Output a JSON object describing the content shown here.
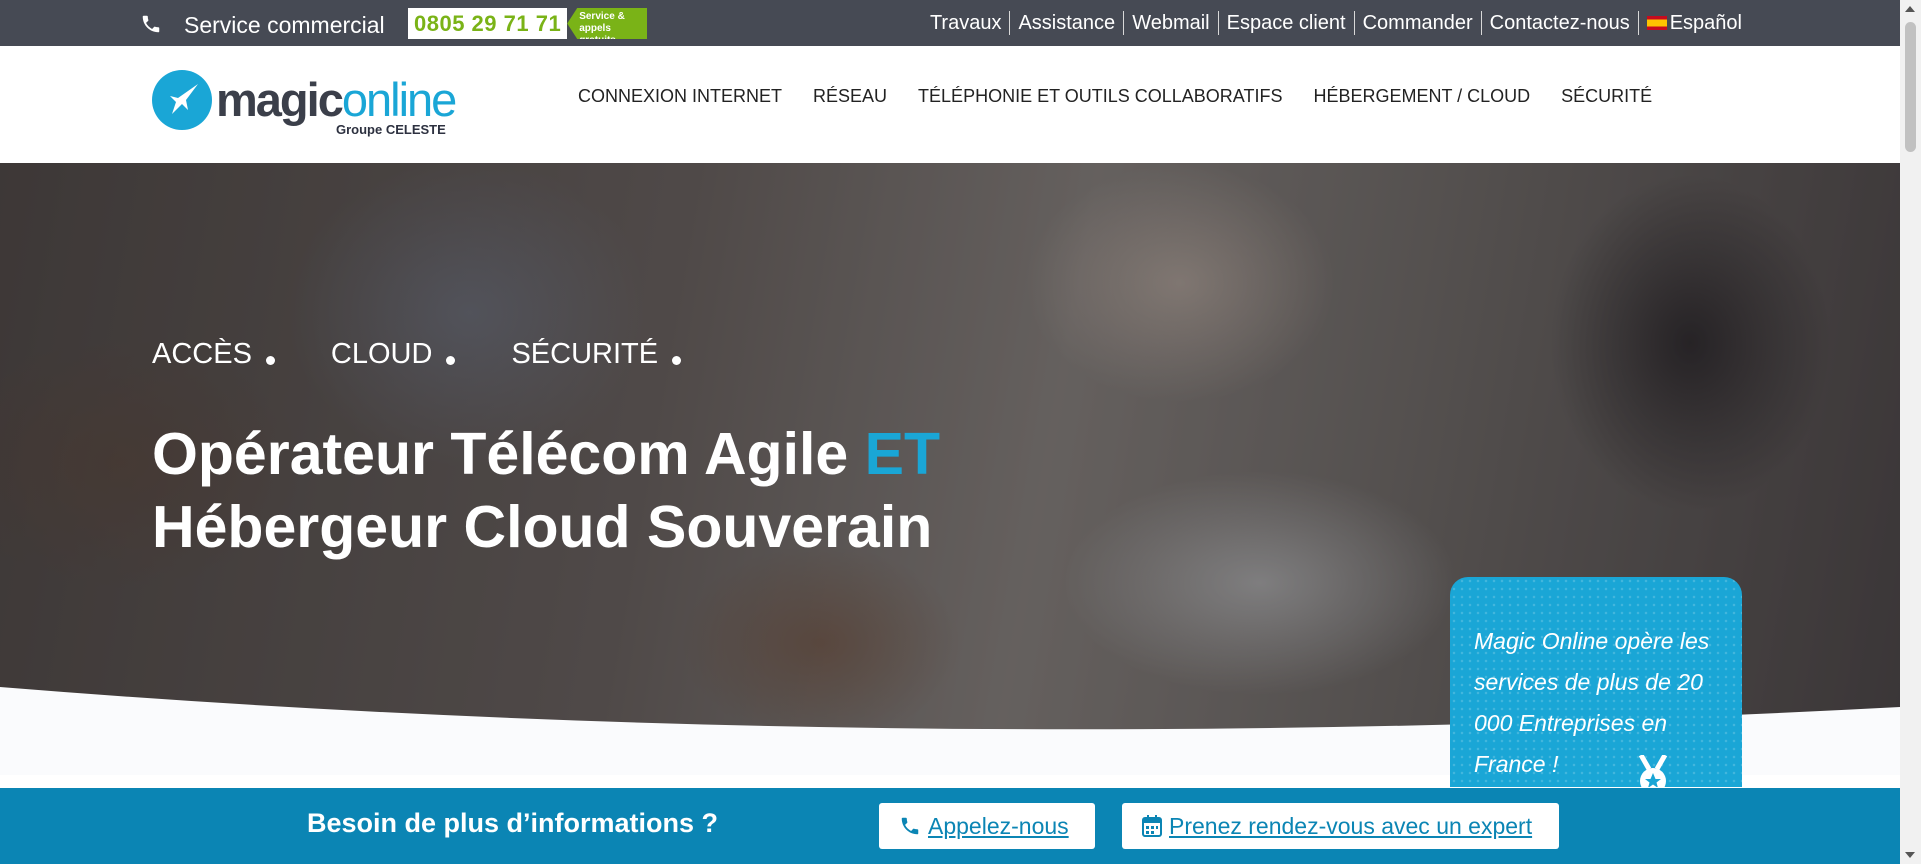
{
  "topbar": {
    "phone_icon": "phone-icon",
    "service_label": "Service commercial",
    "number": "0805 29 71 71",
    "number_tag": "Service & appels gratuits",
    "links": [
      "Travaux",
      "Assistance",
      "Webmail",
      "Espace client",
      "Commander",
      "Contactez-nous"
    ],
    "language": "Español",
    "language_flag": "spain-flag-icon"
  },
  "header": {
    "logo_main": "magic",
    "logo_accent": "online",
    "logo_group": "Groupe CELESTE",
    "nav": [
      "CONNEXION INTERNET",
      "RÉSEAU",
      "TÉLÉPHONIE ET OUTILS COLLABORATIFS",
      "HÉBERGEMENT / CLOUD",
      "SÉCURITÉ"
    ]
  },
  "hero": {
    "pillars": [
      "ACCÈS",
      "CLOUD",
      "SÉCURITÉ"
    ],
    "title_line1": "Opérateur Télécom Agile",
    "title_accent": "ET",
    "title_line2": "Hébergeur Cloud Souverain"
  },
  "card": {
    "text": "Magic Online opère les services de plus de 20 000 Entreprises en France !",
    "icon": "medal-icon"
  },
  "cta": {
    "label": "Besoin de plus d’informations ?",
    "call_button": "Appelez-nous",
    "appointment_button": "Prenez rendez-vous avec un expert"
  },
  "colors": {
    "brand_blue": "#1aa6d6",
    "cta_blue": "#0b85b4",
    "topbar": "#464a54",
    "green": "#7ab317"
  }
}
